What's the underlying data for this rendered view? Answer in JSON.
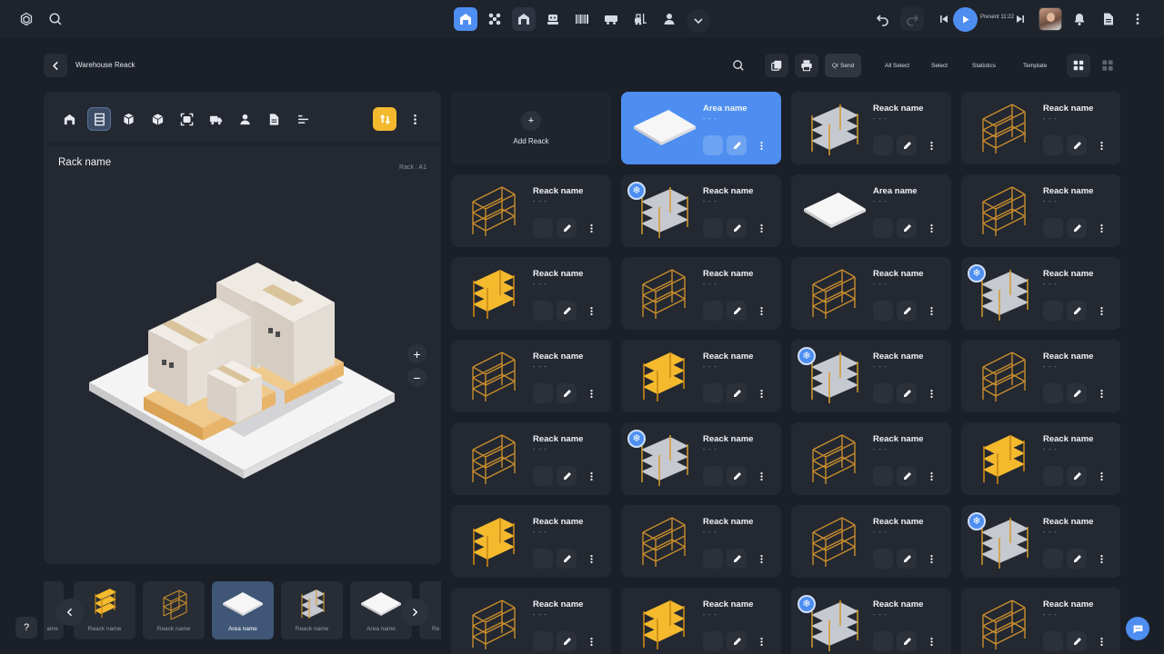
{
  "topbar": {
    "present_label": "Present 11:22",
    "icons": [
      "logo-icon",
      "search-icon",
      "warehouse-icon",
      "drone-icon",
      "garage-icon",
      "robot-icon",
      "barcode-icon",
      "truck-icon",
      "forklift-icon",
      "user-icon",
      "chevron-down-icon"
    ],
    "right_icons": [
      "undo-icon",
      "redo-icon",
      "skip-back-icon",
      "play-icon",
      "skip-forward-icon",
      "avatar",
      "bell-icon",
      "document-icon",
      "more-icon"
    ]
  },
  "header": {
    "title": "Warehouse Reack",
    "qr_send": "Qr Send",
    "all_select": "All Select",
    "select": "Select",
    "statistics": "Statistics",
    "template": "Template"
  },
  "left_panel": {
    "rack_name": "Rack name",
    "rack_code": "Rack : A1",
    "zoom_in": "+",
    "zoom_out": "−"
  },
  "thumbnails": [
    {
      "label": "ame",
      "type": "partial"
    },
    {
      "label": "Reack name",
      "type": "yellow"
    },
    {
      "label": "Reack name",
      "type": "frame"
    },
    {
      "label": "Area name",
      "type": "area",
      "selected": true
    },
    {
      "label": "Reack name",
      "type": "gray"
    },
    {
      "label": "Area name",
      "type": "area"
    },
    {
      "label": "Re",
      "type": "partial"
    }
  ],
  "grid": {
    "add_label": "Add Reack",
    "add_symbol": "+",
    "cards": [
      {
        "title": "Area name",
        "sub": "- - -",
        "type": "area",
        "selected": true
      },
      {
        "title": "Reack name",
        "sub": "- - -",
        "type": "gray"
      },
      {
        "title": "Reack name",
        "sub": "- - -",
        "type": "frame"
      },
      {
        "title": "Reack name",
        "sub": "- - -",
        "type": "frame"
      },
      {
        "title": "Reack name",
        "sub": "- - -",
        "type": "gray",
        "snow": true
      },
      {
        "title": "Area name",
        "sub": "- - -",
        "type": "area"
      },
      {
        "title": "Reack name",
        "sub": "- - -",
        "type": "frame"
      },
      {
        "title": "Reack name",
        "sub": "- - -",
        "type": "yellow"
      },
      {
        "title": "Reack name",
        "sub": "- - -",
        "type": "frame"
      },
      {
        "title": "Reack name",
        "sub": "- - -",
        "type": "frame"
      },
      {
        "title": "Reack name",
        "sub": "- - -",
        "type": "gray",
        "snow": true
      },
      {
        "title": "Reack name",
        "sub": "- - -",
        "type": "frame"
      },
      {
        "title": "Reack name",
        "sub": "- - -",
        "type": "yellow"
      },
      {
        "title": "Reack name",
        "sub": "- - -",
        "type": "gray",
        "snow": true
      },
      {
        "title": "Reack name",
        "sub": "- - -",
        "type": "frame"
      },
      {
        "title": "Reack name",
        "sub": "- - -",
        "type": "frame"
      },
      {
        "title": "Reack name",
        "sub": "- - -",
        "type": "gray",
        "snow": true
      },
      {
        "title": "Reack name",
        "sub": "- - -",
        "type": "frame"
      },
      {
        "title": "Reack name",
        "sub": "- - -",
        "type": "yellow"
      },
      {
        "title": "Reack name",
        "sub": "- - -",
        "type": "yellow"
      },
      {
        "title": "Reack name",
        "sub": "- - -",
        "type": "frame"
      },
      {
        "title": "Reack name",
        "sub": "- - -",
        "type": "frame"
      },
      {
        "title": "Reack name",
        "sub": "- - -",
        "type": "gray",
        "snow": true
      },
      {
        "title": "Reack name",
        "sub": "- - -",
        "type": "frame"
      },
      {
        "title": "Reack name",
        "sub": "- - -",
        "type": "yellow"
      },
      {
        "title": "Reack name",
        "sub": "- - -",
        "type": "gray",
        "snow": true
      },
      {
        "title": "Reack name",
        "sub": "- - -",
        "type": "frame"
      }
    ]
  },
  "colors": {
    "accent": "#4d8ef0",
    "rack_yellow": "#f5b92e",
    "rack_orange": "#d99a28",
    "shelf_gray": "#c7cad0"
  }
}
